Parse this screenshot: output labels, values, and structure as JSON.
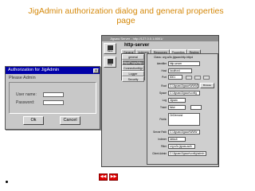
{
  "slide": {
    "title": "JigAdmin authorization dialog and general properties page"
  },
  "auth_dialog": {
    "window_title": "Authorization for JigAdmin",
    "close_glyph": "x",
    "heading": "Please Admin",
    "username_label": "User name:",
    "username_value": "",
    "password_label": "Password:",
    "password_value": "",
    "ok_label": "Ok",
    "cancel_label": "Cancel"
  },
  "properties_window": {
    "window_title": "Jigsaw Server - http://127.0.0.1:8001/",
    "header": "http-server",
    "toolbar": [
      {
        "label": "Save",
        "icon": "save-icon"
      },
      {
        "label": "Stop",
        "icon": "stop-icon"
      }
    ],
    "tabs": [
      "General",
      "Indexers",
      "Resources",
      "Properties",
      "Realms"
    ],
    "list_items": [
      "general",
      "HttpdProps/http-server",
      "ConnectionMgr",
      "Logger",
      "Security"
    ],
    "form_head": "Class: org.w3c.jigsaw.http.httpd",
    "fields": [
      {
        "label": "Identifier",
        "value": "http-server"
      },
      {
        "label": "Host",
        "value": "localhost"
      },
      {
        "label": "Port",
        "value": "8001"
      },
      {
        "label": "Root",
        "value": "C:\\Jigsaw\\Jigsaw\\WWW",
        "button": "Browse"
      },
      {
        "label": "Space",
        "value": "C:\\Jigsaw\\Jigsaw\\config"
      },
      {
        "label": "Log",
        "value": "Jigsaw"
      },
      {
        "label": "Trace",
        "value": "false"
      },
      {
        "label": "Public",
        "value": "OnDemand"
      },
      {
        "label": "Server Path",
        "value": "C:\\Jigsaw\\Jigsaw\\WWW"
      },
      {
        "label": "Indexer",
        "value": "default"
      },
      {
        "label": "Filter",
        "value": "org.w3c.jigsaw.auth"
      },
      {
        "label": "Client Admin",
        "value": "C:\\Jigsaw\\Jigsaw\\config\\admin"
      }
    ]
  },
  "navigation": {
    "prev_glyph": "◀◀",
    "next_glyph": "▶▶"
  }
}
